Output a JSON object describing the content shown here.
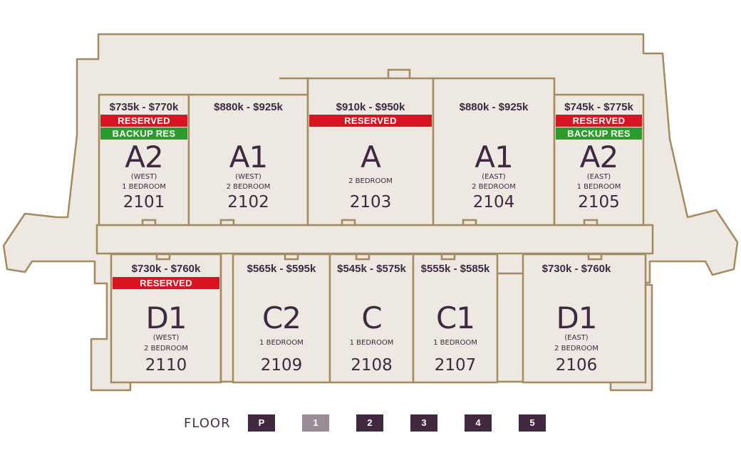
{
  "floor_selector": {
    "label": "FLOOR",
    "floors": [
      {
        "label": "P",
        "active": false
      },
      {
        "label": "1",
        "active": true
      },
      {
        "label": "2",
        "active": false
      },
      {
        "label": "3",
        "active": false
      },
      {
        "label": "4",
        "active": false
      },
      {
        "label": "5",
        "active": false
      }
    ]
  },
  "units": [
    {
      "price": "$735k - $770k",
      "tags": [
        {
          "text": "RESERVED",
          "color": "red"
        },
        {
          "text": "BACKUP RES",
          "color": "green"
        }
      ],
      "type": "A2",
      "side": "(WEST)",
      "beds": "1 BEDROOM",
      "number": "2101"
    },
    {
      "price": "$880k - $925k",
      "tags": [],
      "type": "A1",
      "side": "(WEST)",
      "beds": "2 BEDROOM",
      "number": "2102"
    },
    {
      "price": "$910k - $950k",
      "tags": [
        {
          "text": "RESERVED",
          "color": "red"
        }
      ],
      "type": "A",
      "side": "",
      "beds": "2 BEDROOM",
      "number": "2103"
    },
    {
      "price": "$880k - $925k",
      "tags": [],
      "type": "A1",
      "side": "(EAST)",
      "beds": "2 BEDROOM",
      "number": "2104"
    },
    {
      "price": "$745k - $775k",
      "tags": [
        {
          "text": "RESERVED",
          "color": "red"
        },
        {
          "text": "BACKUP RES",
          "color": "green"
        }
      ],
      "type": "A2",
      "side": "(EAST)",
      "beds": "1 BEDROOM",
      "number": "2105"
    },
    {
      "price": "$730k - $760k",
      "tags": [
        {
          "text": "RESERVED",
          "color": "red"
        }
      ],
      "type": "D1",
      "side": "(WEST)",
      "beds": "2 BEDROOM",
      "number": "2110"
    },
    {
      "price": "$565k - $595k",
      "tags": [],
      "type": "C2",
      "side": "",
      "beds": "1 BEDROOM",
      "number": "2109"
    },
    {
      "price": "$545k - $575k",
      "tags": [],
      "type": "C",
      "side": "",
      "beds": "1 BEDROOM",
      "number": "2108"
    },
    {
      "price": "$555k - $585k",
      "tags": [],
      "type": "C1",
      "side": "",
      "beds": "1 BEDROOM",
      "number": "2107"
    },
    {
      "price": "$730k - $760k",
      "tags": [],
      "type": "D1",
      "side": "(EAST)",
      "beds": "2 BEDROOM",
      "number": "2106"
    }
  ],
  "colors": {
    "wall": "#a58a5e",
    "fill": "#ede8e1",
    "text": "#3f2840",
    "reserved": "#d7141f",
    "backup": "#2c9a2d",
    "floor_button": "#3f2840",
    "floor_button_active": "#9a8b97"
  }
}
